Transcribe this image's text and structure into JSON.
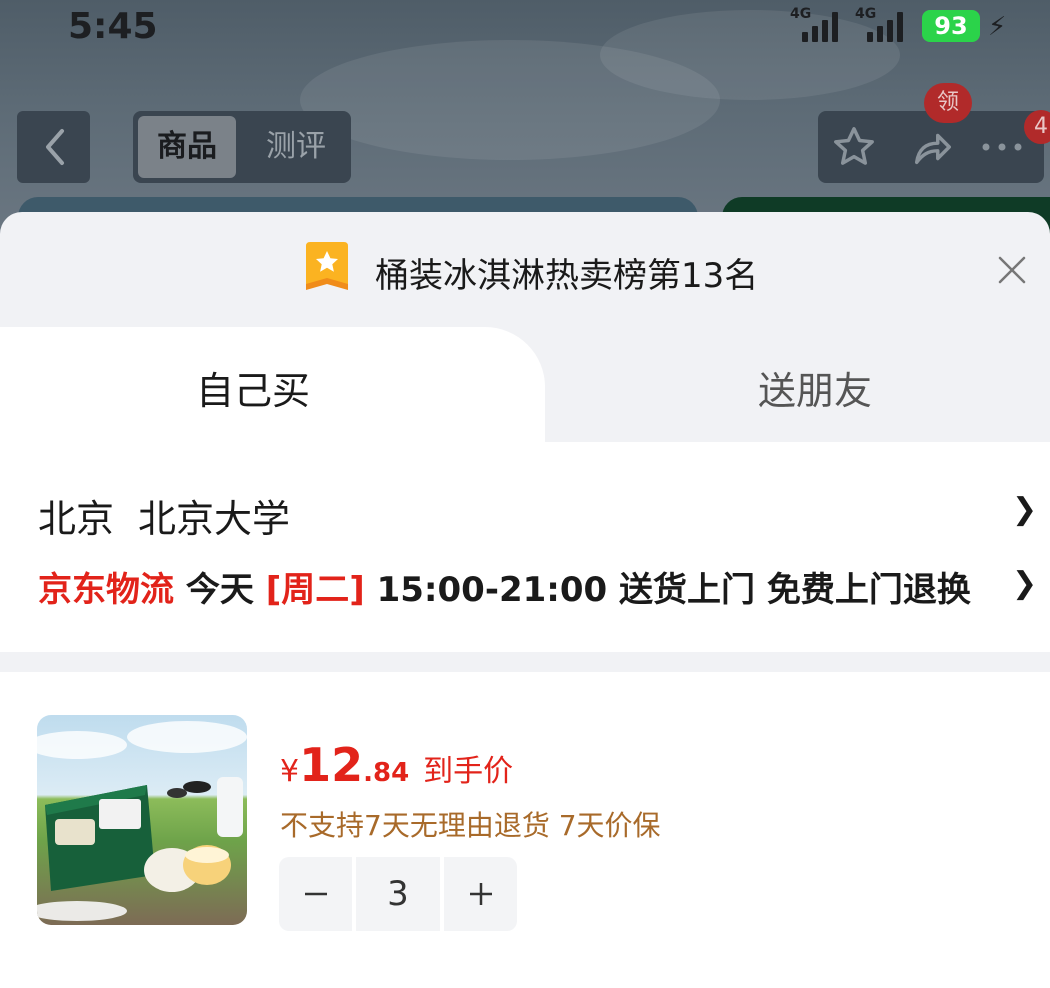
{
  "status_bar": {
    "time": "5:45",
    "signal1_label": "4G",
    "signal2_label": "4G",
    "battery": "93"
  },
  "nav": {
    "tabs": [
      {
        "label": "商品",
        "active": true
      },
      {
        "label": "测评",
        "active": false
      }
    ],
    "coupon_badge": "领",
    "more_badge": "4"
  },
  "sheet": {
    "rank_text": "桶装冰淇淋热卖榜第13名",
    "tabs": {
      "self": "自己买",
      "gift": "送朋友"
    },
    "address": {
      "city": "北京",
      "place": "北京大学"
    },
    "delivery": {
      "carrier": "京东物流",
      "day": "今天",
      "weekday": "[周二]",
      "time_window": "15:00-21:00",
      "service": "送货上门 免费上门退换"
    },
    "product": {
      "currency": "¥",
      "price_int": "12",
      "price_dec": ".84",
      "price_tag": "到手价",
      "policy": "不支持7天无理由退货 7天价保",
      "quantity": "3"
    }
  },
  "colors": {
    "accent_red": "#e2231a",
    "policy_brown": "#a86a2a",
    "battery_green": "#2bd34a"
  },
  "icons": [
    "back-icon",
    "star-icon",
    "share-icon",
    "more-icon",
    "rank-badge-icon",
    "close-icon",
    "chevron-right-icon",
    "minus-icon",
    "plus-icon"
  ]
}
